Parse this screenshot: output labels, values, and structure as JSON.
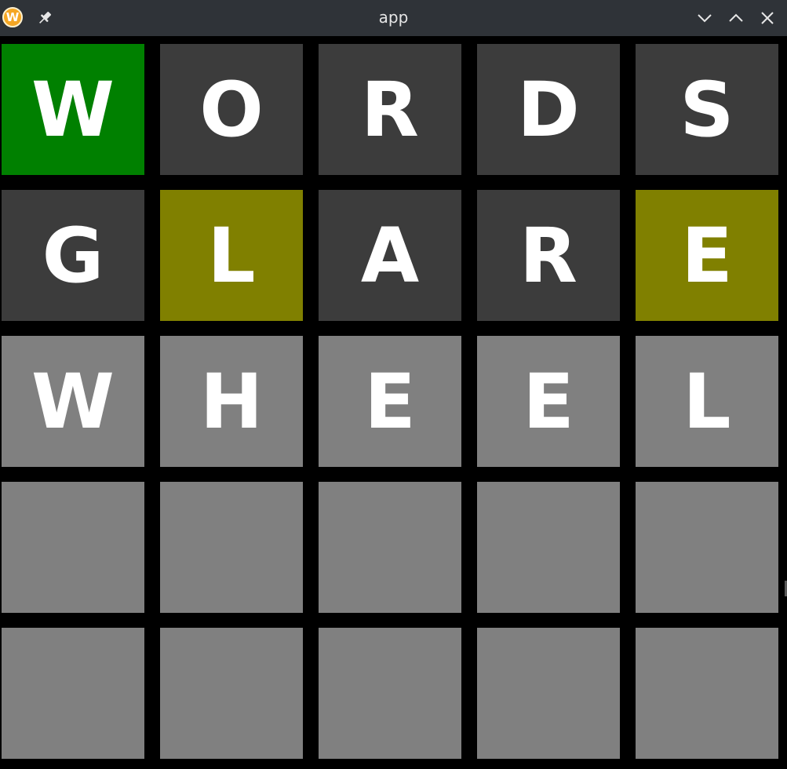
{
  "window": {
    "title": "app",
    "app_icon_letter": "W",
    "icons": {
      "app": "wordle-app-icon",
      "pin": "pin-icon",
      "minimize": "chevron-down-icon",
      "maximize": "chevron-up-icon",
      "close": "close-icon"
    },
    "colors": {
      "titlebar": "#2f3338",
      "background": "#000000"
    }
  },
  "board": {
    "colors": {
      "correct": "#008000",
      "present": "#808000",
      "absent": "#3c3c3c",
      "pending": "#808080",
      "empty": "#808080",
      "letter": "#ffffff"
    },
    "rows": [
      [
        {
          "letter": "W",
          "state": "correct"
        },
        {
          "letter": "O",
          "state": "absent"
        },
        {
          "letter": "R",
          "state": "absent"
        },
        {
          "letter": "D",
          "state": "absent"
        },
        {
          "letter": "S",
          "state": "absent"
        }
      ],
      [
        {
          "letter": "G",
          "state": "absent"
        },
        {
          "letter": "L",
          "state": "present"
        },
        {
          "letter": "A",
          "state": "absent"
        },
        {
          "letter": "R",
          "state": "absent"
        },
        {
          "letter": "E",
          "state": "present"
        }
      ],
      [
        {
          "letter": "W",
          "state": "pending"
        },
        {
          "letter": "H",
          "state": "pending"
        },
        {
          "letter": "E",
          "state": "pending"
        },
        {
          "letter": "E",
          "state": "pending"
        },
        {
          "letter": "L",
          "state": "pending"
        }
      ],
      [
        {
          "letter": "",
          "state": "empty"
        },
        {
          "letter": "",
          "state": "empty"
        },
        {
          "letter": "",
          "state": "empty"
        },
        {
          "letter": "",
          "state": "empty"
        },
        {
          "letter": "",
          "state": "empty"
        }
      ],
      [
        {
          "letter": "",
          "state": "empty"
        },
        {
          "letter": "",
          "state": "empty"
        },
        {
          "letter": "",
          "state": "empty"
        },
        {
          "letter": "",
          "state": "empty"
        },
        {
          "letter": "",
          "state": "empty"
        }
      ]
    ]
  }
}
